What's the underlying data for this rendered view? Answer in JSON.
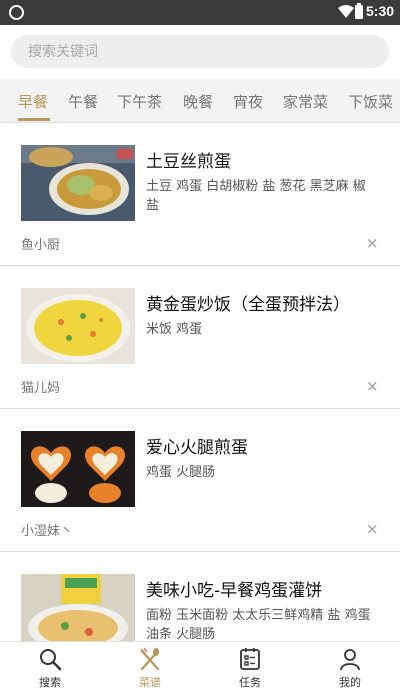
{
  "status_bar": {
    "time": "5:30"
  },
  "search": {
    "placeholder": "搜索关键词"
  },
  "tabs": [
    {
      "label": "早餐",
      "active": true
    },
    {
      "label": "午餐",
      "active": false
    },
    {
      "label": "下午茶",
      "active": false
    },
    {
      "label": "晚餐",
      "active": false
    },
    {
      "label": "宵夜",
      "active": false
    },
    {
      "label": "家常菜",
      "active": false
    },
    {
      "label": "下饭菜",
      "active": false
    }
  ],
  "recipes": [
    {
      "title": "土豆丝煎蛋",
      "ingredients": "土豆 鸡蛋 白胡椒粉 盐 葱花 黑芝麻 椒盐",
      "author": "鱼小厨",
      "close": "×"
    },
    {
      "title": "黄金蛋炒饭（全蛋预拌法）",
      "ingredients": "米饭 鸡蛋",
      "author": "猫儿妈",
      "close": "×"
    },
    {
      "title": "爱心火腿煎蛋",
      "ingredients": "鸡蛋 火腿肠",
      "author": "小湿妹丶",
      "close": "×"
    },
    {
      "title": "美味小吃-早餐鸡蛋灌饼",
      "ingredients": "面粉 玉米面粉 太太乐三鲜鸡精 盐 鸡蛋 油条 火腿肠",
      "author": "",
      "close": ""
    }
  ],
  "bottom_nav": [
    {
      "label": "搜索",
      "icon": "search-icon",
      "active": false
    },
    {
      "label": "菜谱",
      "icon": "fork-spoon-icon",
      "active": true
    },
    {
      "label": "任务",
      "icon": "task-icon",
      "active": false
    },
    {
      "label": "我的",
      "icon": "person-icon",
      "active": false
    }
  ],
  "colors": {
    "accent": "#b5985a",
    "status_bar": "#3b3b3b",
    "tab_bar": "#f3f3f3"
  }
}
